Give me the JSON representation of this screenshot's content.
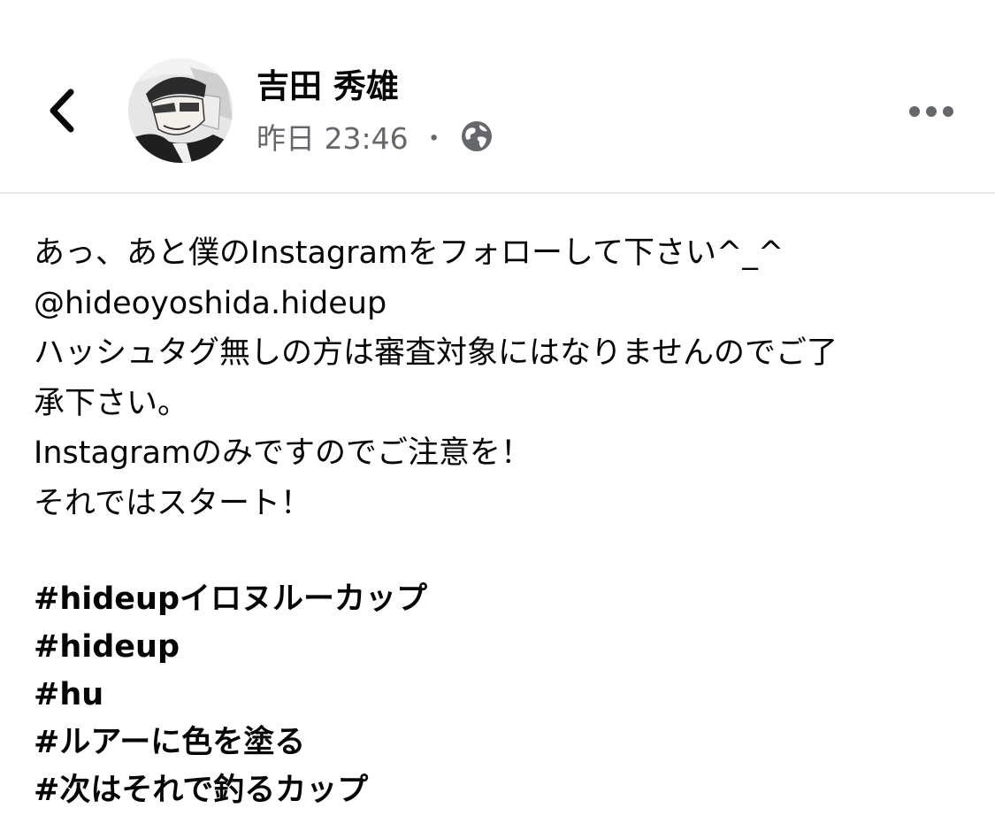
{
  "header": {
    "author_name": "吉田 秀雄",
    "timestamp": "昨日 23:46",
    "separator": "・",
    "privacy_icon": "globe-icon",
    "back_icon": "chevron-left-icon",
    "more_icon": "more-horizontal-icon"
  },
  "post": {
    "lines": [
      "あっ、あと僕のInstagramをフォローして下さい^_^",
      "@hideoyoshida.hideup",
      "ハッシュタグ無しの方は審査対象にはなりませんのでご了",
      "承下さい。",
      "Instagramのみですのでご注意を！",
      "それではスタート！"
    ],
    "hashtags": [
      "#hideupイロヌルーカップ",
      "#hideup",
      "#hu",
      "#ルアーに色を塗る",
      "#次はそれで釣るカップ"
    ]
  },
  "colors": {
    "text_primary": "#050505",
    "text_secondary": "#65676b",
    "divider": "#e4e6eb",
    "background": "#ffffff"
  }
}
